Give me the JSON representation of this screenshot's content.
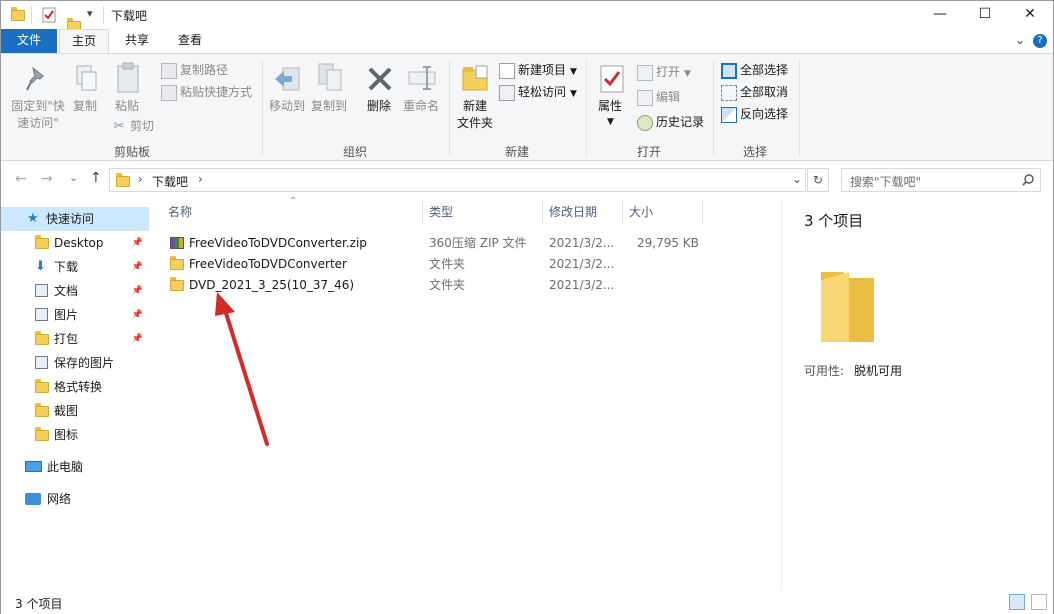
{
  "window": {
    "title": "下载吧",
    "minimize_glyph": "—",
    "maximize_glyph": "☐",
    "close_glyph": "✕"
  },
  "quick_access_toolbar": {
    "dropdown_glyph": "▾"
  },
  "ribbon_tabs": {
    "file": "文件",
    "home": "主页",
    "share": "共享",
    "view": "查看",
    "expand_glyph": "⌄",
    "help_glyph": "?"
  },
  "ribbon": {
    "clipboard": {
      "label": "剪贴板",
      "pin_line1": "固定到\"快",
      "pin_line2": "速访问\"",
      "copy": "复制",
      "paste": "粘贴",
      "copy_path": "复制路径",
      "paste_shortcut": "粘贴快捷方式",
      "cut": "剪切"
    },
    "organize": {
      "label": "组织",
      "move_to": "移动到",
      "copy_to": "复制到",
      "delete": "删除",
      "rename": "重命名"
    },
    "new": {
      "label": "新建",
      "new_folder_line1": "新建",
      "new_folder_line2": "文件夹",
      "new_item": "新建项目",
      "easy_access": "轻松访问"
    },
    "open": {
      "label": "打开",
      "properties": "属性",
      "open": "打开",
      "edit": "编辑",
      "history": "历史记录"
    },
    "select": {
      "label": "选择",
      "select_all": "全部选择",
      "select_none": "全部取消",
      "invert": "反向选择"
    }
  },
  "address_bar": {
    "back_glyph": "←",
    "forward_glyph": "→",
    "recent_glyph": "⌄",
    "up_glyph": "↑",
    "crumb_sep": "›",
    "path": "下载吧",
    "dropdown_glyph": "⌄",
    "refresh_glyph": "↻",
    "search_placeholder": "搜索\"下载吧\""
  },
  "nav_pane": {
    "quick_access": "快速访问",
    "items": [
      {
        "label": "Desktop",
        "pinned": true,
        "icon": "folder-icon"
      },
      {
        "label": "下载",
        "pinned": true,
        "icon": "download-icon"
      },
      {
        "label": "文档",
        "pinned": true,
        "icon": "document-icon"
      },
      {
        "label": "图片",
        "pinned": true,
        "icon": "picture-icon"
      },
      {
        "label": "打包",
        "pinned": true,
        "icon": "folder-icon"
      },
      {
        "label": "保存的图片",
        "pinned": false,
        "icon": "picture-icon"
      },
      {
        "label": "格式转换",
        "pinned": false,
        "icon": "folder-icon"
      },
      {
        "label": "截图",
        "pinned": false,
        "icon": "folder-icon"
      },
      {
        "label": "图标",
        "pinned": false,
        "icon": "folder-icon"
      }
    ],
    "this_pc": "此电脑",
    "network": "网络"
  },
  "file_list": {
    "sort_glyph": "⌃",
    "columns": {
      "name": "名称",
      "type": "类型",
      "date": "修改日期",
      "size": "大小"
    },
    "rows": [
      {
        "name": "FreeVideoToDVDConverter.zip",
        "type": "360压缩 ZIP 文件",
        "date": "2021/3/2...",
        "size": "29,795 KB",
        "icon": "zip-archive-icon"
      },
      {
        "name": "FreeVideoToDVDConverter",
        "type": "文件夹",
        "date": "2021/3/2...",
        "size": "",
        "icon": "folder-icon"
      },
      {
        "name": "DVD_2021_3_25(10_37_46)",
        "type": "文件夹",
        "date": "2021/3/2...",
        "size": "",
        "icon": "folder-icon"
      }
    ]
  },
  "details_pane": {
    "count": "3 个项目",
    "availability_label": "可用性:",
    "availability_value": "脱机可用"
  },
  "status_bar": {
    "count": "3 个项目"
  },
  "colors": {
    "accent": "#1a6fc0",
    "folder": "#f5cf5d",
    "arrow": "#d32a2a"
  }
}
